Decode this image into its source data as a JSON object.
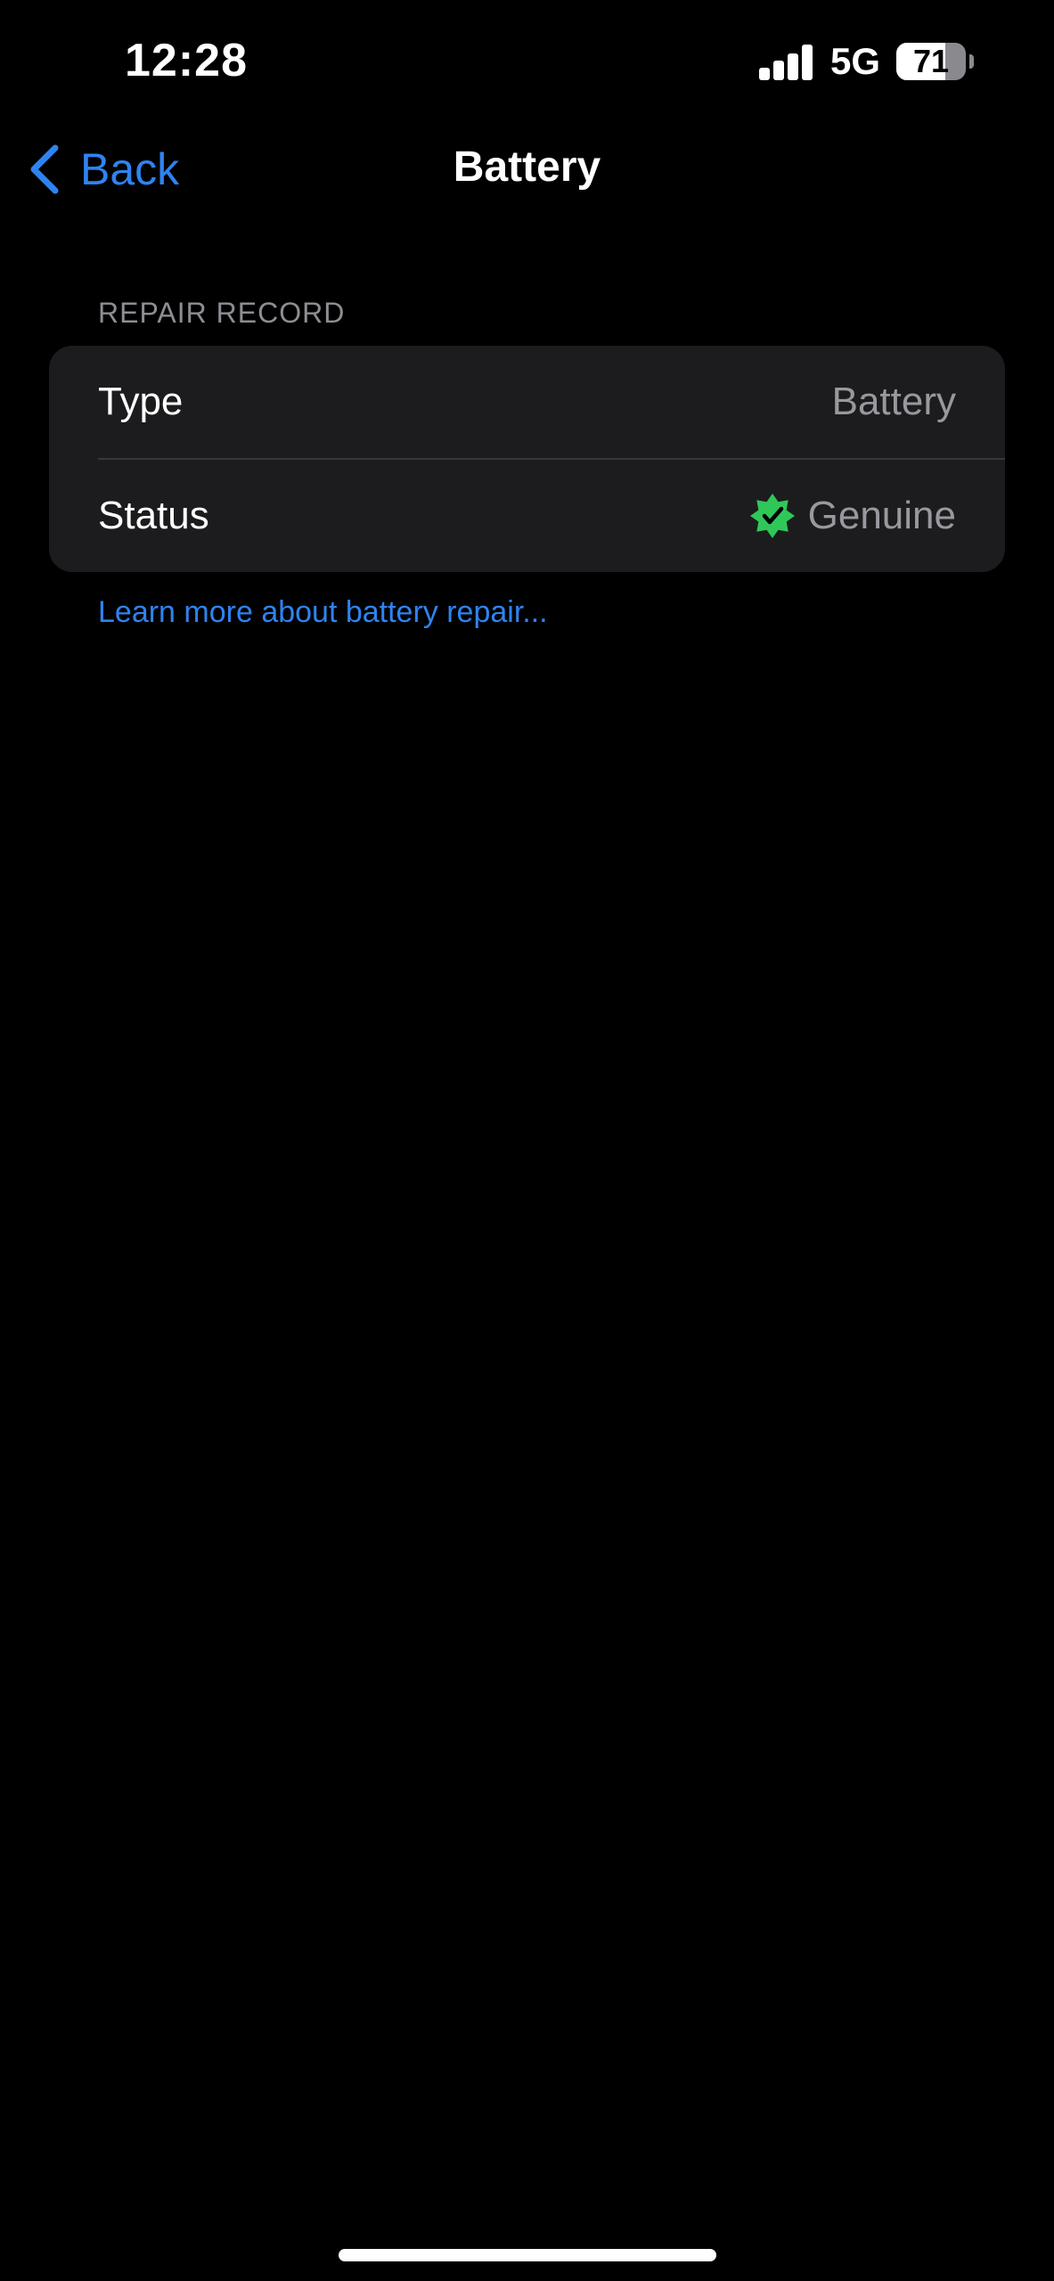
{
  "status_bar": {
    "time": "12:28",
    "network": "5G",
    "battery_level": "71",
    "battery_percent": 71,
    "signal_bars": 4,
    "icons": [
      "signal-icon",
      "battery-icon"
    ]
  },
  "nav": {
    "back_label": "Back",
    "back_icon": "chevron-left-icon",
    "title": "Battery"
  },
  "repair_record": {
    "header": "REPAIR RECORD",
    "rows": [
      {
        "label": "Type",
        "value": "Battery"
      },
      {
        "label": "Status",
        "value": "Genuine",
        "icon": "verified-badge-icon"
      }
    ],
    "link": "Learn more about battery repair..."
  },
  "colors": {
    "background": "#000000",
    "accent": "#2f83f0",
    "group_background": "#1c1c1e",
    "secondary_text": "#98989e",
    "verified": "#30c759"
  }
}
